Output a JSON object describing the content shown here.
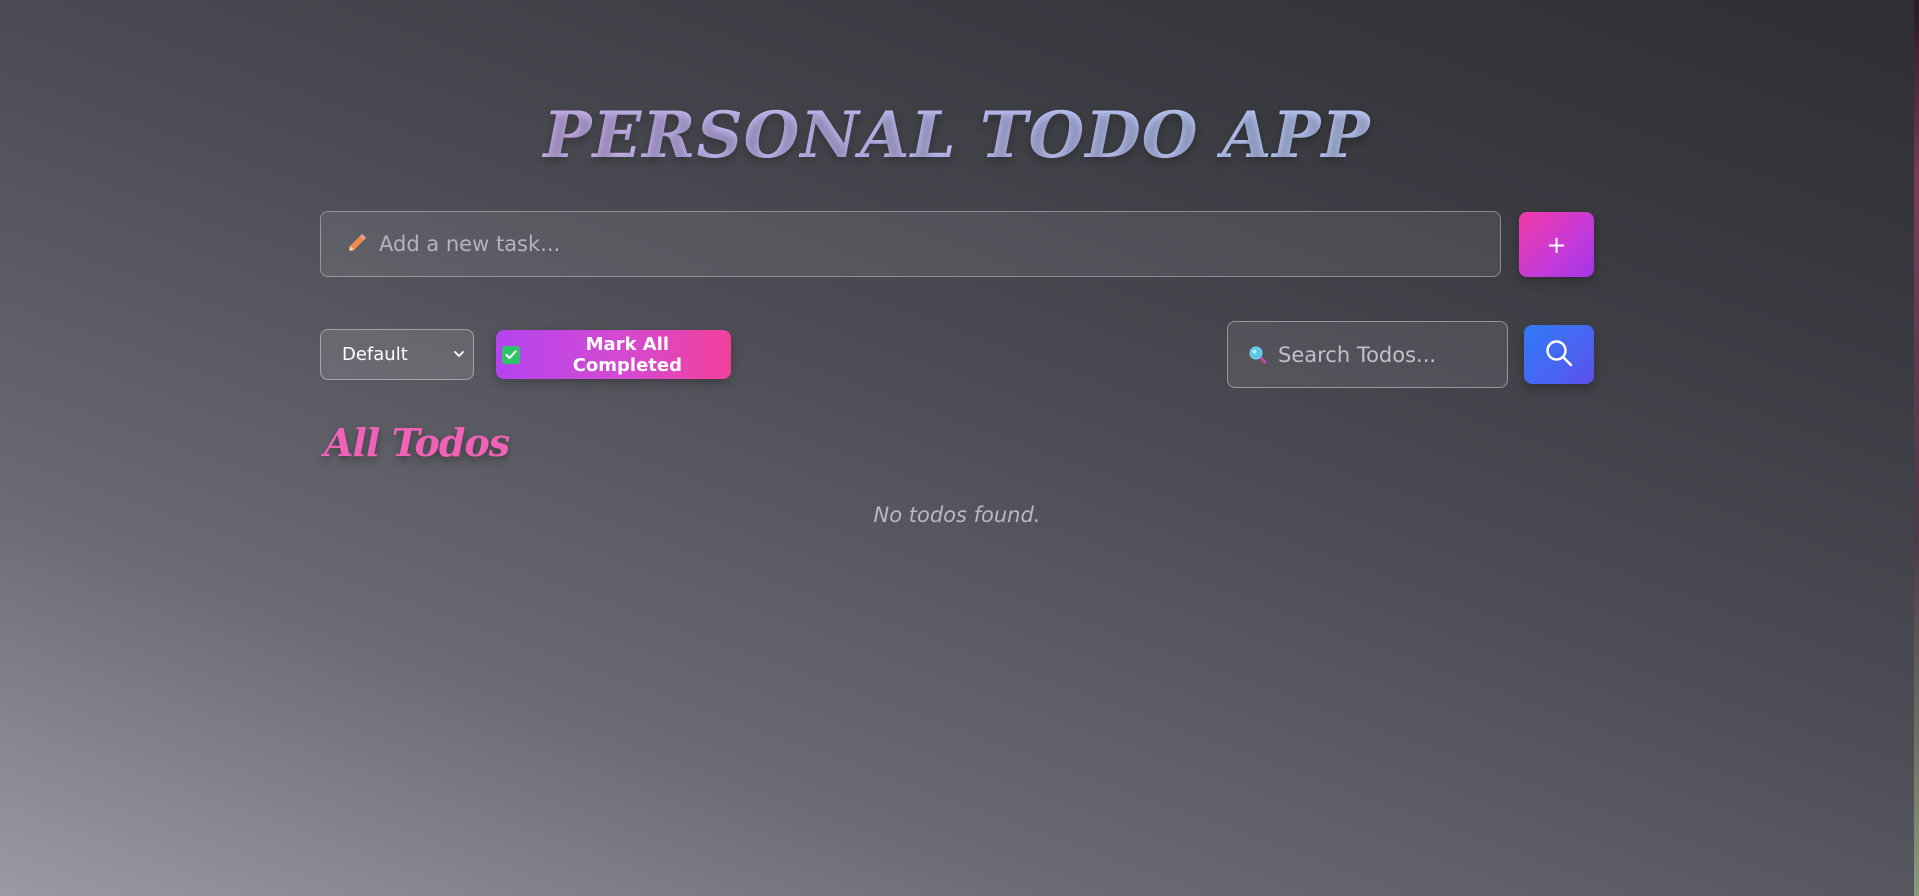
{
  "app": {
    "title": "PERSONAL TODO APP"
  },
  "add_task": {
    "icon": "pencil-icon",
    "placeholder": "Add a new task...",
    "value": "",
    "button_label": "+"
  },
  "controls": {
    "sort": {
      "selected": "Default",
      "options": [
        "Default"
      ]
    },
    "mark_all": {
      "icon": "check-icon",
      "label": "Mark All Completed"
    },
    "search": {
      "icon": "magnifier-icon",
      "placeholder": "Search Todos...",
      "value": "",
      "button_icon": "search-icon"
    }
  },
  "todos": {
    "heading": "All Todos",
    "items": [],
    "empty_message": "No todos found."
  },
  "colors": {
    "accent_pink": "#f062b8",
    "add_button": "#e63ab8",
    "search_button": "#3f6df3",
    "mark_all_button": "#d44ad0"
  }
}
